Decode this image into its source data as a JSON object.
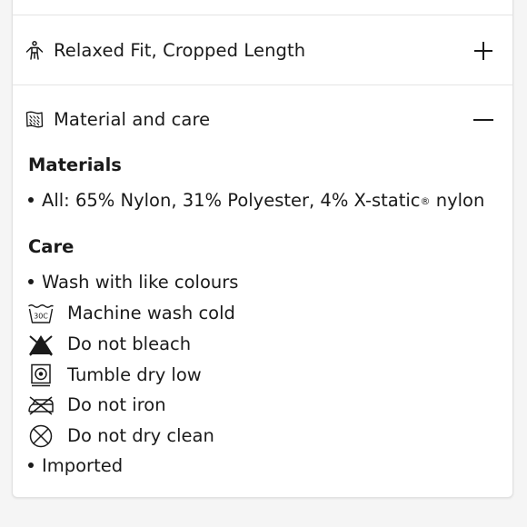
{
  "accordion": {
    "fit": {
      "title": "Relaxed Fit, Cropped Length",
      "toggle_icon": "plus-icon",
      "icon": "person-icon"
    },
    "material": {
      "title": "Material and care",
      "toggle_icon": "minus-icon",
      "icon": "fabric-tag-icon"
    }
  },
  "materials": {
    "heading": "Materials",
    "item": "All: 65% Nylon, 31% Polyester, 4% X-static",
    "item_reg": "®",
    "item_tail": " nylon"
  },
  "care": {
    "heading": "Care",
    "items": [
      {
        "label": "Wash with like colours",
        "type": "bullet"
      },
      {
        "label": "Machine wash cold",
        "type": "icon",
        "icon": "wash-30-icon",
        "icon_text": "30C"
      },
      {
        "label": "Do not bleach",
        "type": "icon",
        "icon": "no-bleach-icon"
      },
      {
        "label": "Tumble dry low",
        "type": "icon",
        "icon": "tumble-dry-low-icon"
      },
      {
        "label": "Do not iron",
        "type": "icon",
        "icon": "no-iron-icon"
      },
      {
        "label": "Do not dry clean",
        "type": "icon",
        "icon": "no-dry-clean-icon"
      },
      {
        "label": "Imported",
        "type": "bullet"
      }
    ]
  },
  "colors": {
    "text": "#1a1a1a",
    "divider": "#e4e4e4",
    "background": "#f5f5f5",
    "card": "#ffffff"
  }
}
